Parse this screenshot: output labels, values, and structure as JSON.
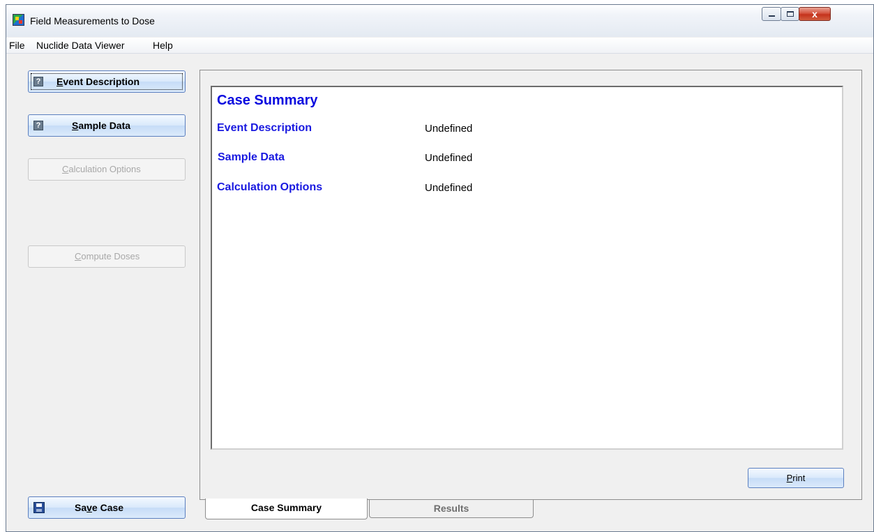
{
  "window": {
    "title": "Field Measurements to Dose",
    "controls": {
      "minimize": "",
      "maximize": "",
      "close": "x"
    }
  },
  "menu": {
    "items": [
      {
        "label": "File"
      },
      {
        "label": "Nuclide Data Viewer"
      },
      {
        "label": "Help"
      }
    ]
  },
  "left_buttons": {
    "event_description": {
      "pre": "",
      "ul": "E",
      "post": "vent Description"
    },
    "sample_data": {
      "pre": "",
      "ul": "S",
      "post": "ample Data"
    },
    "calculation_options": {
      "pre": "",
      "ul": "C",
      "post": "alculation Options"
    },
    "compute_doses": {
      "pre": "",
      "ul": "C",
      "post": "ompute Doses"
    },
    "save_case": {
      "pre": "Sa",
      "ul": "v",
      "post": "e Case"
    }
  },
  "summary": {
    "title": "Case Summary",
    "rows": [
      {
        "label": "Event Description",
        "value": "Undefined"
      },
      {
        "label": "Sample Data",
        "value": "Undefined"
      },
      {
        "label": "Calculation Options",
        "value": "Undefined"
      }
    ]
  },
  "print_button": {
    "pre": "",
    "ul": "P",
    "post": "rint"
  },
  "tabs": [
    {
      "label": "Case Summary",
      "active": true
    },
    {
      "label": "Results",
      "active": false
    }
  ]
}
